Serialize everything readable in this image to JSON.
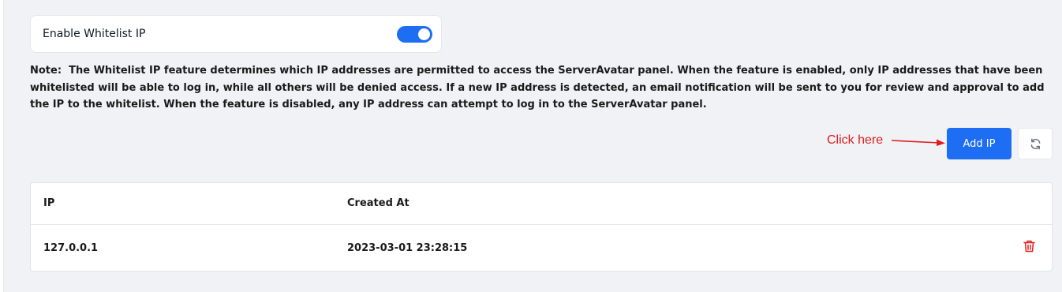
{
  "whitelist": {
    "toggle_label": "Enable Whitelist IP",
    "enabled": true
  },
  "note": {
    "prefix": "Note:",
    "text": "The Whitelist IP feature determines which IP addresses are permitted to access the ServerAvatar panel. When the feature is enabled, only IP addresses that have been whitelisted will be able to log in, while all others will be denied access. If a new IP address is detected, an email notification will be sent to you for review and approval to add the IP to the whitelist. When the feature is disabled, any IP address can attempt to log in to the ServerAvatar panel."
  },
  "annotation": {
    "callout_text": "Click here",
    "color": "#e11d1d"
  },
  "toolbar": {
    "add_label": "Add IP",
    "refresh_icon": "refresh-icon"
  },
  "table": {
    "columns": [
      "IP",
      "Created At"
    ],
    "rows": [
      {
        "ip": "127.0.0.1",
        "created_at": "2023-03-01 23:28:15",
        "action_icon": "trash-icon"
      }
    ]
  },
  "colors": {
    "accent": "#1d6ef2",
    "danger": "#e11d1d",
    "background": "#f1f2f6"
  }
}
